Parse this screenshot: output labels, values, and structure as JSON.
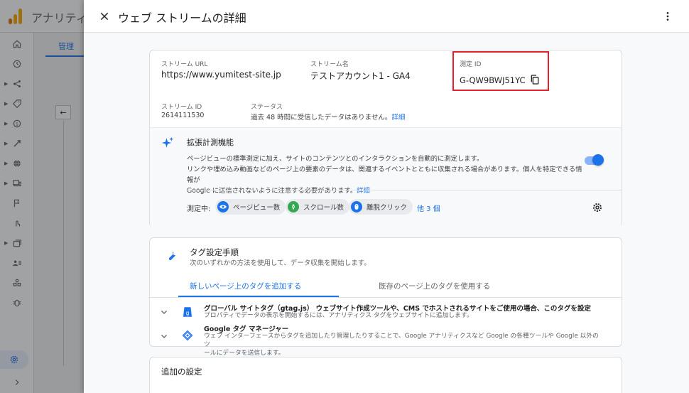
{
  "background": {
    "app_title": "アナリティ",
    "tab_label": "管理",
    "back_arrow": "←"
  },
  "panel": {
    "title": "ウェブ ストリームの詳細",
    "close_glyph": "✕",
    "more_glyph": "⋮"
  },
  "stream": {
    "url_label": "ストリーム URL",
    "url_value": "https://www.yumitest-site.jp",
    "name_label": "ストリーム名",
    "name_value": "テストアカウント1 - GA4",
    "measurement_id_label": "測定 ID",
    "measurement_id_value": "G-QW9BWJ51YC",
    "stream_id_label": "ストリーム ID",
    "stream_id_value": "2614111530",
    "status_label": "ステータス",
    "status_value": "過去 48 時間に受信したデータはありません。",
    "status_link": "詳細"
  },
  "enhanced": {
    "title": "拡張計測機能",
    "desc_line1": "ページビューの標準測定に加え、サイトのコンテンツとのインタラクションを自動的に測定します。",
    "desc_line2": "リンクや埋め込み動画などのページ上の要素のデータは、関連するイベントとともに収集される場合があります。個人を特定できる情報が",
    "desc_line3": "Google に送信されないように注意する必要があります。",
    "desc_link": "詳細",
    "toggle_on": true,
    "measuring_label": "測定中:",
    "chips": [
      {
        "label": "ページビュー数",
        "icon": "eye-icon",
        "color": "#1a73e8"
      },
      {
        "label": "スクロール数",
        "icon": "compass-icon",
        "color": "#34a853"
      },
      {
        "label": "離脱クリック",
        "icon": "mouse-icon",
        "color": "#1a73e8"
      }
    ],
    "more_link": "他 3 個"
  },
  "tag_setup": {
    "title": "タグ設定手順",
    "subtitle": "次のいずれかの方法を使用して、データ収集を開始します。",
    "tabs": [
      {
        "label": "新しいページ上のタグを追加する",
        "active": true
      },
      {
        "label": "既存のページ上のタグを使用する",
        "active": false
      }
    ],
    "rows": [
      {
        "title": "グローバル サイトタグ（gtag.js） ウェブサイト作成ツールや、CMS でホストされるサイトをご使用の場合、このタグを設定",
        "desc1": "プロパティでデータの表示を開始するには、アナリティクス タグをウェブサイトに追加します。",
        "desc2": ""
      },
      {
        "title": "Google タグ マネージャー",
        "desc1": "ウェブ インターフェースからタグを追加したり管理したりすることで、Google アナリティクスなど Google の各種ツールや Google 以外のツ",
        "desc2": "ールにデータを送信します。"
      }
    ]
  },
  "additional": {
    "title": "追加の設定"
  },
  "colors": {
    "accent": "#1a73e8",
    "highlight_box": "#e8202b"
  }
}
